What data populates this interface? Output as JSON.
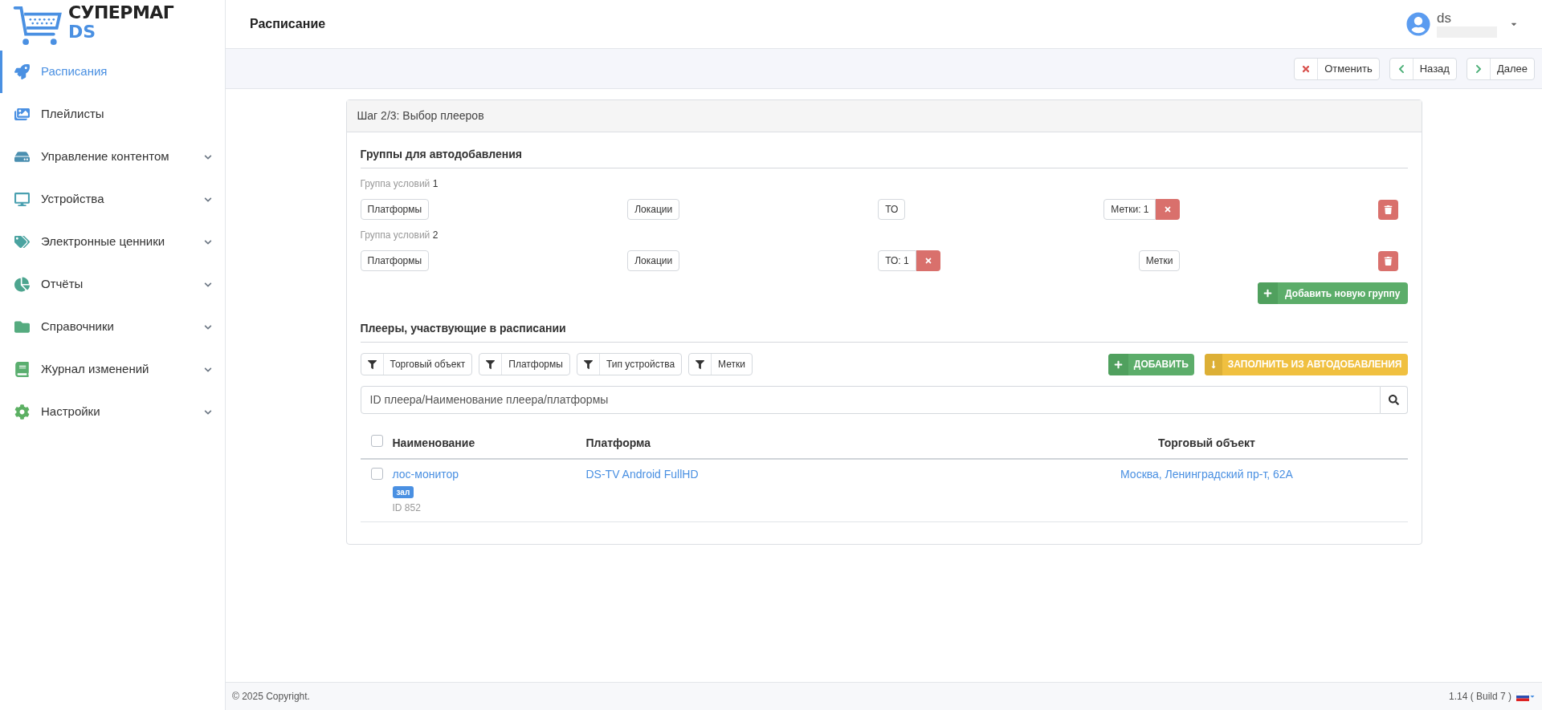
{
  "logo": {
    "title": "СУПЕРМАГ",
    "subtitle": "DS"
  },
  "sidebar": {
    "items": [
      {
        "label": "Расписания",
        "selected": true,
        "expandable": false
      },
      {
        "label": "Плейлисты",
        "selected": false,
        "expandable": false
      },
      {
        "label": "Управление контентом",
        "selected": false,
        "expandable": true
      },
      {
        "label": "Устройства",
        "selected": false,
        "expandable": true
      },
      {
        "label": "Электронные ценники",
        "selected": false,
        "expandable": true
      },
      {
        "label": "Отчёты",
        "selected": false,
        "expandable": true
      },
      {
        "label": "Справочники",
        "selected": false,
        "expandable": true
      },
      {
        "label": "Журнал изменений",
        "selected": false,
        "expandable": true
      },
      {
        "label": "Настройки",
        "selected": false,
        "expandable": true
      }
    ]
  },
  "header": {
    "title": "Расписание",
    "user": "ds"
  },
  "toolbar": {
    "buttons": [
      {
        "kind": "cancel",
        "label": "Отменить"
      },
      {
        "kind": "back",
        "label": "Назад"
      },
      {
        "kind": "next",
        "label": "Далее"
      }
    ]
  },
  "card": {
    "title": "Шаг 2/3: Выбор плееров",
    "groups_section": {
      "heading": "Группы для автодобавления",
      "groups": [
        {
          "caption": "Группа условий",
          "number": "1",
          "filters": [
            {
              "label": "Платформы",
              "clearable": false
            },
            {
              "label": "Локации",
              "clearable": false
            },
            {
              "label": "ТО",
              "clearable": false
            },
            {
              "label": "Метки: 1",
              "clearable": true
            }
          ]
        },
        {
          "caption": "Группа условий",
          "number": "2",
          "filters": [
            {
              "label": "Платформы",
              "clearable": false
            },
            {
              "label": "Локации",
              "clearable": false
            },
            {
              "label": "ТО: 1",
              "clearable": true
            },
            {
              "label": "Метки",
              "clearable": false
            }
          ]
        }
      ],
      "add_button": "Добавить новую группу"
    },
    "players_section": {
      "heading": "Плееры, участвующие в расписании",
      "filters": [
        "Торговый объект",
        "Платформы",
        "Тип устройства",
        "Метки"
      ],
      "add_button": "ДОБАВИТЬ",
      "fill_button": "ЗАПОЛНИТЬ ИЗ АВТОДОБАВЛЕНИЯ",
      "search": {
        "placeholder": "ID плеера/Наименование плеера/платформы"
      },
      "table": {
        "select_all_checked": false,
        "columns": [
          "Наименование",
          "Платформа",
          "Торговый объект"
        ],
        "rows": [
          {
            "checked": false,
            "name": "лос-монитор",
            "tag": "зал",
            "id": "ID 852",
            "platform": "DS-TV Android FullHD",
            "object": "Москва, Ленинградский пр-т, 62А"
          }
        ]
      }
    }
  },
  "footer": {
    "copyright": "© 2025 Copyright.",
    "version": "1.14 ( Build 7 )"
  }
}
